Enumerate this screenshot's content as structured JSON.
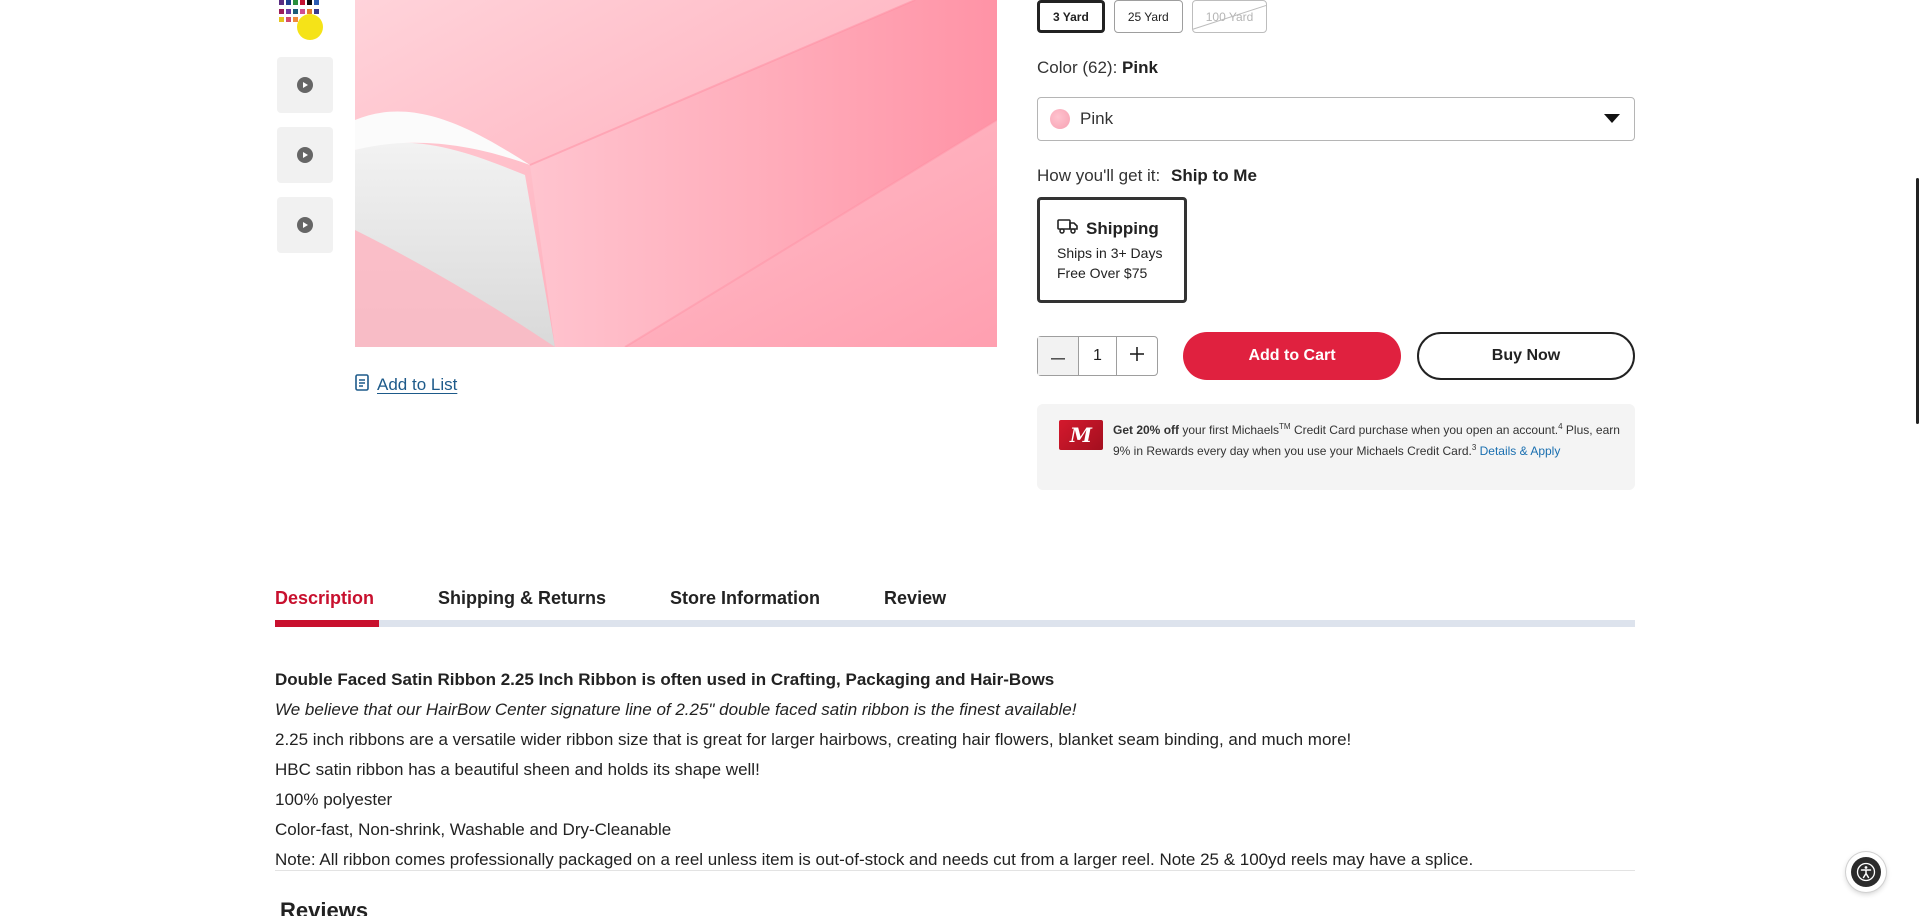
{
  "sizes": {
    "options": [
      {
        "label": "3 Yard",
        "state": "selected"
      },
      {
        "label": "25 Yard",
        "state": "available"
      },
      {
        "label": "100 Yard",
        "state": "unavailable"
      }
    ]
  },
  "color": {
    "label_prefix": "Color (62):",
    "selected_name": "Pink",
    "select_value": "Pink"
  },
  "fulfillment": {
    "label": "How you'll get it:",
    "selected": "Ship to Me",
    "card": {
      "title": "Shipping",
      "line1": "Ships in 3+ Days",
      "line2": "Free Over $75"
    }
  },
  "purchase": {
    "quantity": "1",
    "add_to_cart": "Add to Cart",
    "buy_now": "Buy Now"
  },
  "add_to_list": "Add to List",
  "promo": {
    "card_mark": "M",
    "bold": "Get 20% off",
    "text1": " your first Michaels",
    "tm": "TM",
    "text2": " Credit Card purchase when you open an account.",
    "sup1": "4",
    "text3": " Plus, earn 9% in Rewards every day when you use your Michaels Credit Card.",
    "sup2": "3",
    "link": "Details & Apply"
  },
  "tabs": [
    {
      "label": "Description",
      "active": true
    },
    {
      "label": "Shipping & Returns",
      "active": false
    },
    {
      "label": "Store Information",
      "active": false
    },
    {
      "label": "Review",
      "active": false
    }
  ],
  "description": {
    "title": "Double Faced Satin Ribbon 2.25 Inch Ribbon is often used in Crafting, Packaging and Hair-Bows",
    "tagline": "We believe that our HairBow Center signature line of 2.25\" double faced satin ribbon is the finest available!",
    "lines": [
      "2.25 inch ribbons are a versatile wider ribbon size that is great for larger hairbows, creating hair flowers, blanket seam binding, and much more!",
      "HBC satin ribbon has a beautiful sheen and holds its shape well!",
      "100% polyester",
      "Color-fast, Non-shrink, Washable and Dry-Cleanable",
      "Note: All ribbon comes professionally packaged on a reel unless item is out-of-stock and needs cut from a larger reel. Note 25 & 100yd reels may have a splice."
    ]
  },
  "reviews_heading": "Reviews",
  "icons": {
    "thumbnail_video": "play-icon",
    "shipping": "truck-icon",
    "list": "list-icon",
    "quantity_decrease": "minus-icon",
    "quantity_increase": "plus-icon",
    "dropdown": "chevron-down-icon",
    "accessibility": "accessibility-icon"
  },
  "colors": {
    "accent_red": "#e0213f",
    "tab_active": "#c8102e",
    "link_blue": "#1a6fb0",
    "product_pink": "#f6a1b2"
  }
}
